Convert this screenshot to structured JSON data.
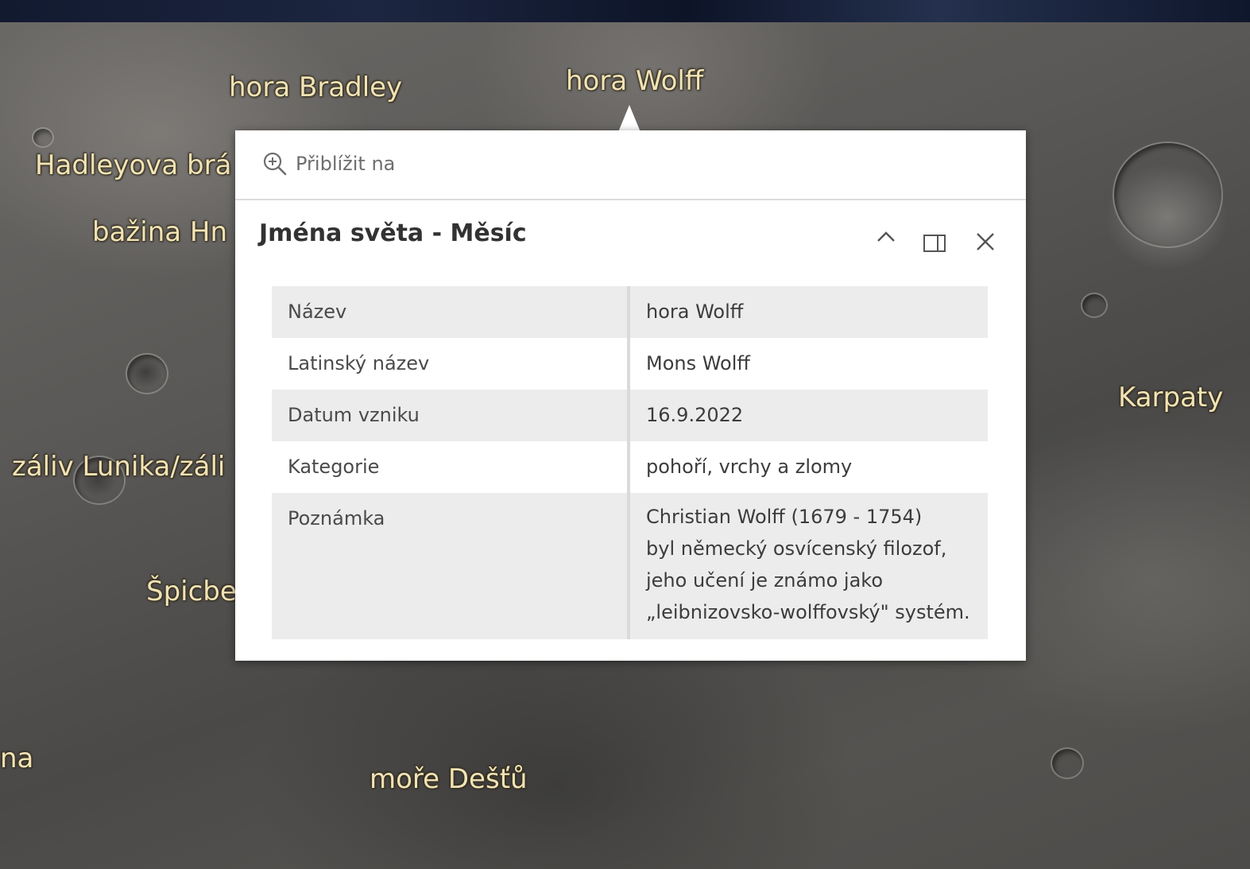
{
  "map": {
    "labels": [
      {
        "id": "hora-bradley",
        "text": "hora Bradley"
      },
      {
        "id": "hora-wolff",
        "text": "hora Wolff"
      },
      {
        "id": "hadleyova",
        "text": "Hadleyova brá"
      },
      {
        "id": "bazina",
        "text": "bažina Hn"
      },
      {
        "id": "zaliv",
        "text": "záliv Lunika/záli"
      },
      {
        "id": "spicbe",
        "text": "Špicbe"
      },
      {
        "id": "na",
        "text": "na"
      },
      {
        "id": "more-destu",
        "text": "moře Dešťů"
      },
      {
        "id": "karpaty",
        "text": "Karpaty"
      }
    ]
  },
  "popup": {
    "zoom_label": "Přiblížit na",
    "title": "Jména světa - Měsíc",
    "icons": {
      "zoom": "zoom-in-icon",
      "collapse": "chevron-up-icon",
      "dock": "dock-icon",
      "close": "close-icon"
    },
    "rows": [
      {
        "key": "Název",
        "value": "hora Wolff"
      },
      {
        "key": "Latinský název",
        "value": "Mons Wolff"
      },
      {
        "key": "Datum vzniku",
        "value": "16.9.2022"
      },
      {
        "key": "Kategorie",
        "value": "pohoří, vrchy a zlomy"
      },
      {
        "key": "Poznámka",
        "value_lines": [
          "Christian Wolff (1679 - 1754)",
          "byl německý osvícenský filozof,",
          "jeho učení je známo jako",
          "„leibnizovsko-wolffovský\" systém."
        ]
      }
    ]
  }
}
